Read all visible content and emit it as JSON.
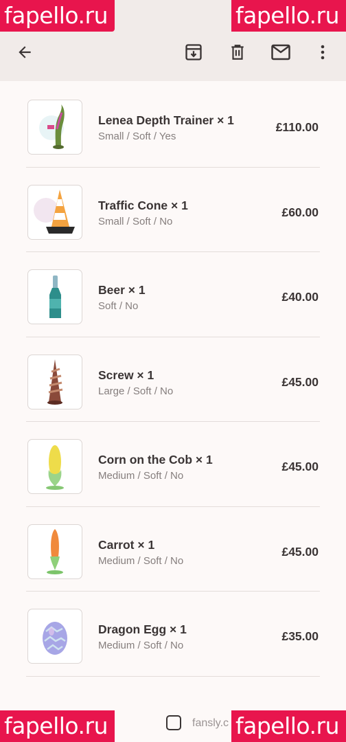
{
  "toolbar": {
    "back_icon": "arrow-back-icon",
    "archive_icon": "archive-icon",
    "delete_icon": "trash-icon",
    "mail_icon": "mail-icon",
    "more_icon": "more-vert-icon"
  },
  "items": [
    {
      "title": "Lenea Depth Trainer × 1",
      "options": "Small / Soft / Yes",
      "price": "£110.00",
      "thumb": "tentacle-product"
    },
    {
      "title": "Traffic Cone × 1",
      "options": "Small / Soft / No",
      "price": "£60.00",
      "thumb": "cone-product"
    },
    {
      "title": "Beer × 1",
      "options": "Soft / No",
      "price": "£40.00",
      "thumb": "bottle-product"
    },
    {
      "title": "Screw × 1",
      "options": "Large / Soft / No",
      "price": "£45.00",
      "thumb": "screw-product"
    },
    {
      "title": "Corn on the Cob × 1",
      "options": "Medium / Soft / No",
      "price": "£45.00",
      "thumb": "corn-product"
    },
    {
      "title": "Carrot × 1",
      "options": "Medium / Soft / No",
      "price": "£45.00",
      "thumb": "carrot-product"
    },
    {
      "title": "Dragon Egg × 1",
      "options": "Medium / Soft / No",
      "price": "£35.00",
      "thumb": "egg-product"
    }
  ],
  "watermark": "fapello.ru",
  "footer_text": "fansly.c",
  "colors": {
    "app_bar": "#f1ebe9",
    "background": "#fdf9f8",
    "watermark": "#e8154d",
    "text": "#3a3434",
    "subtext": "#857e7d"
  }
}
